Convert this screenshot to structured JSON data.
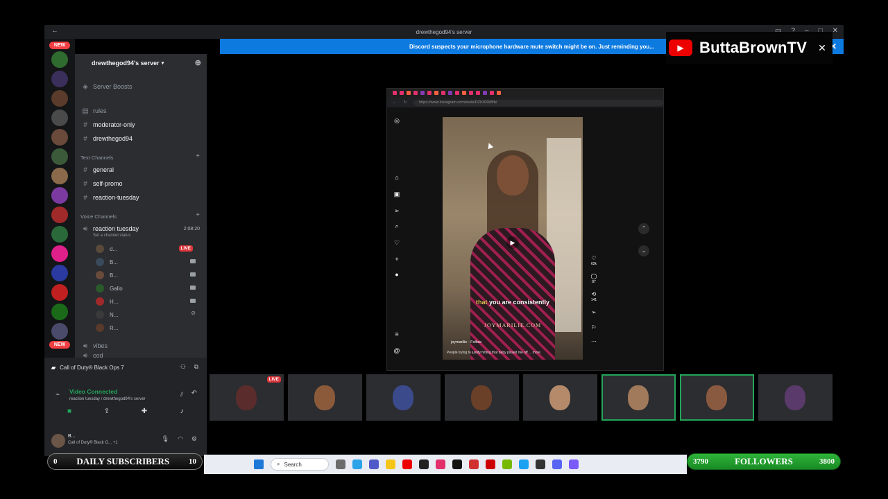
{
  "window": {
    "title": "drewthegod94's server"
  },
  "notice": {
    "text": "Discord suspects your microphone hardware mute switch might be on. Just reminding you..."
  },
  "youtube_badge": {
    "channel": "ButtaBrownTV",
    "close_icon": "close-icon"
  },
  "server_rail": {
    "new_label": "NEW"
  },
  "sidebar": {
    "server_name": "drewthegod94's server",
    "server_boosts": "Server Boosts",
    "channels_top": [
      {
        "label": "rules"
      },
      {
        "label": "moderator-only"
      },
      {
        "label": "drewthegod94"
      }
    ],
    "text_category": "Text Channels",
    "text_channels": [
      {
        "label": "general"
      },
      {
        "label": "self-promo"
      },
      {
        "label": "reaction-tuesday"
      }
    ],
    "voice_category": "Voice Channels",
    "voice_channel": {
      "name": "reaction tuesday",
      "timer": "2:08:20",
      "status_hint": "Set a channel status"
    },
    "voice_users": [
      {
        "name": "d...",
        "live": "LIVE"
      },
      {
        "name": "B..."
      },
      {
        "name": "B..."
      },
      {
        "name": "Gallo"
      },
      {
        "name": "H..."
      },
      {
        "name": "N..."
      },
      {
        "name": "R..."
      }
    ],
    "more_channels": [
      {
        "label": "vibes"
      },
      {
        "label": "cod"
      }
    ]
  },
  "voice_panel": {
    "game": "Call of Duty® Black Ops 7",
    "connection": "Video Connected",
    "location": "reaction tuesday / drewthegod94's server"
  },
  "user_panel": {
    "name": "B...",
    "status": "Call of Duty® Black O... +1"
  },
  "browser": {
    "url": "https://www.instagram.com/reels/DZh30RiBfb/",
    "tab_colors": [
      "#e1306c",
      "#e1306c",
      "#f56040",
      "#e1306c",
      "#833ab4",
      "#e1306c",
      "#f56040",
      "#e1306c",
      "#833ab4",
      "#e1306c",
      "#f56040",
      "#e1306c",
      "#e1306c",
      "#833ab4",
      "#e1306c",
      "#f56040"
    ]
  },
  "reel": {
    "caption_highlight": "that",
    "caption_rest": "you are consistently",
    "watermark": "JOYMARILIE.COM",
    "username": "joymarilie · Follow",
    "description": "People trying to justify hitting that baby pissed me off ... more",
    "like_count": "62k",
    "comment_count": "87",
    "share_count": "141"
  },
  "tiles": [
    {
      "live": "LIVE",
      "speaking": false,
      "face_color": "#5a2c2c"
    },
    {
      "speaking": false,
      "face_color": "#8a5a3a"
    },
    {
      "speaking": false,
      "face_color": "#3a4a8a"
    },
    {
      "speaking": false,
      "face_color": "#6b4028"
    },
    {
      "speaking": false,
      "face_color": "#b48a6a"
    },
    {
      "speaking": true,
      "face_color": "#a07a5a"
    },
    {
      "speaking": true,
      "face_color": "#8a5a40"
    },
    {
      "speaking": false,
      "face_color": "#5a3a6a"
    }
  ],
  "overlays": {
    "subscribers": {
      "title": "DAILY SUBSCRIBERS",
      "current": "0",
      "goal": "10"
    },
    "followers": {
      "title": "FOLLOWERS",
      "current": "3790",
      "goal": "3800"
    }
  },
  "taskbar": {
    "search_placeholder": "Search"
  }
}
